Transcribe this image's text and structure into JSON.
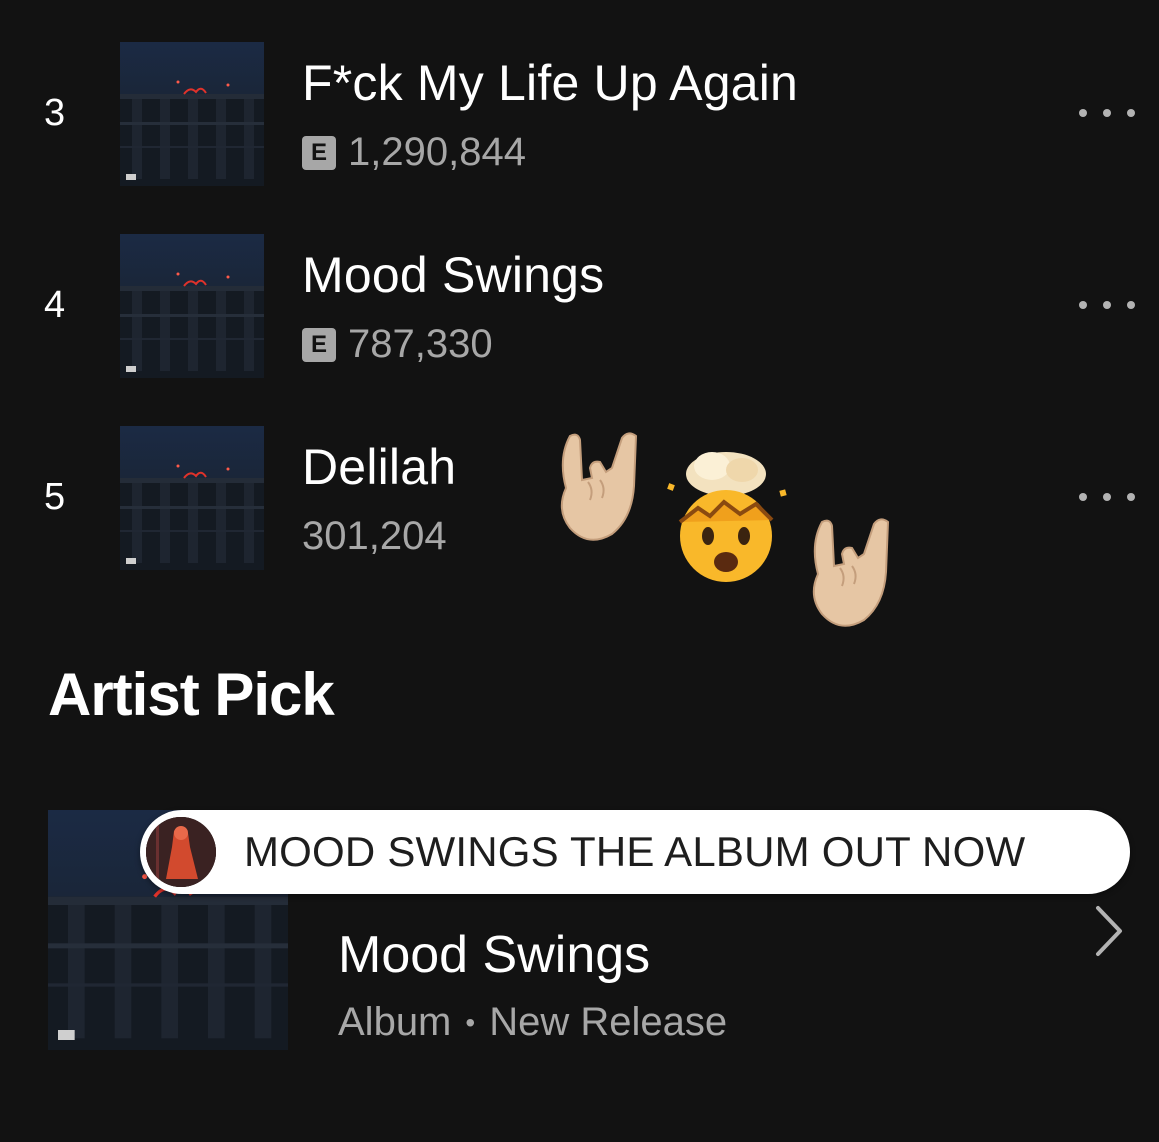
{
  "tracks": [
    {
      "number": "3",
      "title": "F*ck My Life Up Again",
      "explicit": true,
      "explicit_label": "E",
      "plays": "1,290,844"
    },
    {
      "number": "4",
      "title": "Mood Swings",
      "explicit": true,
      "explicit_label": "E",
      "plays": "787,330"
    },
    {
      "number": "5",
      "title": "Delilah",
      "explicit": false,
      "explicit_label": "",
      "plays": "301,204"
    }
  ],
  "overlay_emojis": [
    "sign-of-the-horns-icon",
    "exploding-head-icon",
    "sign-of-the-horns-icon"
  ],
  "artist_pick": {
    "section_title": "Artist Pick",
    "message": "MOOD SWINGS THE ALBUM OUT NOW",
    "title": "Mood Swings",
    "type": "Album",
    "separator": "•",
    "status": "New Release"
  },
  "colors": {
    "background": "#121212",
    "primary_text": "#ffffff",
    "secondary_text": "#a7a7a7",
    "bubble": "#ffffff"
  }
}
